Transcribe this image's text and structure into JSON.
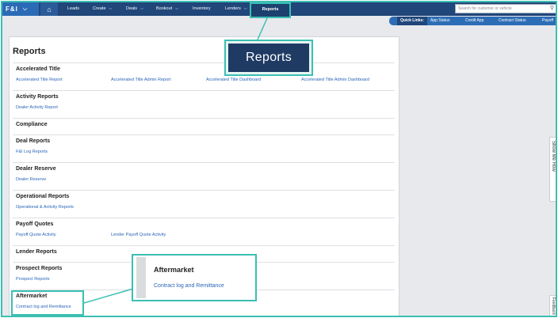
{
  "nav": {
    "brand": "F&I",
    "items": [
      {
        "label": "Leads"
      },
      {
        "label": "Create"
      },
      {
        "label": "Deals"
      },
      {
        "label": "Bookout"
      },
      {
        "label": "Inventory"
      },
      {
        "label": "Lenders"
      },
      {
        "label": "Reports"
      }
    ],
    "search_placeholder": "Search for customer or vehicle"
  },
  "quick_links": {
    "label": "Quick Links:",
    "items": [
      "App Status",
      "Credit App",
      "Contract Status",
      "Payoff"
    ]
  },
  "callout_title": "Reports",
  "panel": {
    "title": "Reports",
    "sections": [
      {
        "title": "Accelerated Title",
        "links": [
          "Accelerated Title Report",
          "Accelerated Title Admin Report",
          "Accelerated Title Dashboard",
          "Accelerated Title Admin Dashboard"
        ]
      },
      {
        "title": "Activity Reports",
        "links": [
          "Dealer Activity Report"
        ]
      },
      {
        "title": "Compliance",
        "links": []
      },
      {
        "title": "Deal Reports",
        "links": [
          "F&I Log Reports"
        ]
      },
      {
        "title": "Dealer Reserve",
        "links": [
          "Dealer Reserve"
        ]
      },
      {
        "title": "Operational Reports",
        "links": [
          "Operational & Activity Reports"
        ]
      },
      {
        "title": "Payoff Quotes",
        "links": [
          "Payoff Quote Activity",
          "Lender Payoff Quote Activity"
        ]
      },
      {
        "title": "Lender Reports",
        "links": []
      },
      {
        "title": "Prospect Reports",
        "links": [
          "Prospect Reports"
        ]
      },
      {
        "title": "Aftermarket",
        "links": [
          "Contract log and Remittance"
        ]
      }
    ]
  },
  "aftermarket_callout": {
    "title": "Aftermarket",
    "link": "Contract log and Remittance"
  },
  "side_tabs": {
    "show_me_how": "Show Me How",
    "feedback": "Feedback"
  }
}
